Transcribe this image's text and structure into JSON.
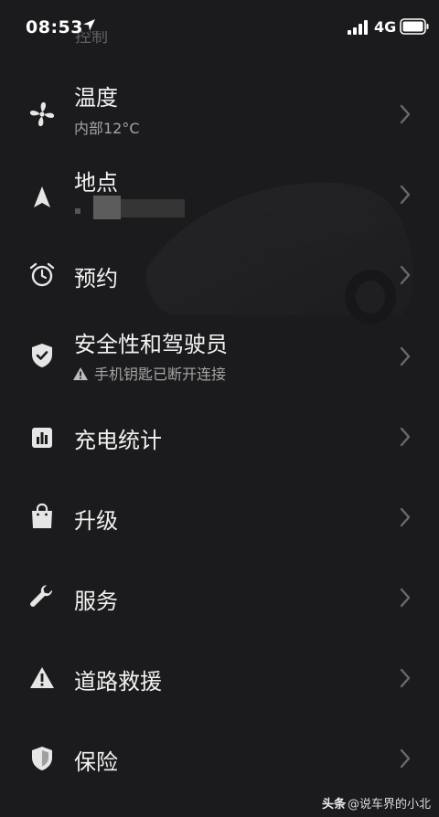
{
  "status_bar": {
    "time": "08:53",
    "network": "4G"
  },
  "scrolled_item_partial": "控制",
  "menu": {
    "items": [
      {
        "label": "温度",
        "sub": "内部12°C",
        "icon": "fan-icon"
      },
      {
        "label": "地点",
        "sub": "",
        "icon": "navigation-arrow-icon"
      },
      {
        "label": "预约",
        "sub": "",
        "icon": "alarm-clock-icon"
      },
      {
        "label": "安全性和驾驶员",
        "sub": "手机钥匙已断开连接",
        "icon": "shield-check-icon",
        "sub_icon": "warning-icon"
      },
      {
        "label": "充电统计",
        "sub": "",
        "icon": "bar-chart-icon"
      },
      {
        "label": "升级",
        "sub": "",
        "icon": "shopping-bag-icon"
      },
      {
        "label": "服务",
        "sub": "",
        "icon": "wrench-icon"
      },
      {
        "label": "道路救援",
        "sub": "",
        "icon": "warning-triangle-icon"
      },
      {
        "label": "保险",
        "sub": "",
        "icon": "shield-icon"
      }
    ]
  },
  "watermark": {
    "brand": "头条",
    "handle": "@说车界的小北"
  },
  "colors": {
    "background": "#1b1b1d",
    "text_primary": "#f2f2f2",
    "text_secondary": "#a4a4a4",
    "chevron": "#6a6a6a"
  }
}
